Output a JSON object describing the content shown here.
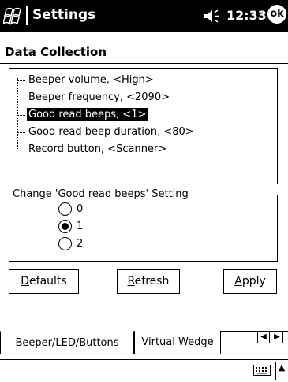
{
  "titlebar": {
    "title": "Settings",
    "clock": "12:33",
    "ok_label": "ok"
  },
  "section": {
    "heading": "Data Collection"
  },
  "tree": {
    "items": [
      {
        "label": "Beeper volume, <High>"
      },
      {
        "label": "Beeper frequency, <2090>"
      },
      {
        "label": "Good read beeps, <1>"
      },
      {
        "label": "Good read beep duration, <80>"
      },
      {
        "label": "Record button, <Scanner>"
      }
    ],
    "selected_index": 2
  },
  "group": {
    "legend": "Change 'Good read beeps' Setting",
    "options": [
      "0",
      "1",
      "2"
    ],
    "selected": "1"
  },
  "buttons": {
    "defaults_accel": "D",
    "defaults_rest": "efaults",
    "refresh_accel": "R",
    "refresh_rest": "efresh",
    "apply_accel": "A",
    "apply_rest": "pply"
  },
  "tabs": {
    "items": [
      {
        "label": "Beeper/LED/Buttons"
      },
      {
        "label": "Virtual Wedge"
      }
    ],
    "active_index": 0
  },
  "icons": {
    "start": "windows-flag-icon",
    "speaker": "speaker-icon",
    "keyboard": "keyboard-icon",
    "scroll_left": "arrow-left-icon",
    "scroll_right": "arrow-right-icon",
    "sip_arrow": "arrow-up-icon"
  }
}
